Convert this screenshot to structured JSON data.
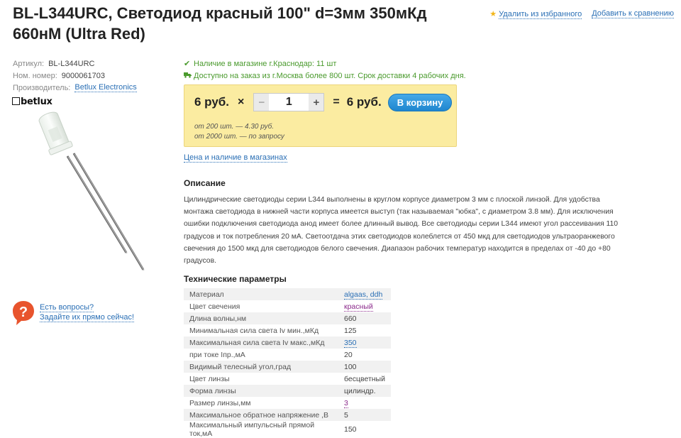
{
  "product": {
    "title": "BL-L344URC, Светодиод красный 100\" d=3мм 350мКд 660нМ (Ultra Red)"
  },
  "actions": {
    "remove_favorite": "Удалить из избранного",
    "add_compare": "Добавить к сравнению"
  },
  "meta": {
    "article_label": "Артикул:",
    "article_value": "BL-L344URC",
    "number_label": "Ном. номер:",
    "number_value": "9000061703",
    "maker_label": "Производитель:",
    "maker_value": "Betlux Electronics"
  },
  "brand_logo": "betlux",
  "availability": {
    "in_store": "Наличие в магазине г.Краснодар: 11 шт",
    "on_order": "Доступно на заказ из г.Москва более 800 шт. Срок доставки 4 рабочих дня."
  },
  "buy": {
    "unit_price": "6 руб.",
    "times": "×",
    "minus": "−",
    "plus": "+",
    "qty": "1",
    "equals": "=",
    "total": "6 руб.",
    "cart_button": "В корзину",
    "tier1": "от 200 шт. — 4.30 руб.",
    "tier2": "от 2000 шт. — по запросу"
  },
  "stores_link": "Цена и наличие в магазинах",
  "description": {
    "heading": "Описание",
    "text": "Цилиндрические светодиоды серии L344 выполнены в круглом корпусе диаметром 3 мм с плоской линзой. Для удобства монтажа светодиода в нижней части корпуса имеется выступ (так называемая \"юбка\", с диаметром 3.8 мм). Для исключения ошибки подключения светодиода анод имеет более длинный вывод. Все светодиоды серии L344 имеют угол рассеивания 110 градусов и ток потребления 20 мА. Светоотдача этих светодиодов колеблется от 450 мкд для светодиодов ультраоранжевого свечения до 1500 мкд для светодиодов белого свечения. Диапазон рабочих температур находится в пределах от -40 до +80 градусов."
  },
  "help": {
    "line1": "Есть вопросы?",
    "line2": "Задайте их прямо сейчас!"
  },
  "specs": {
    "heading": "Технические параметры",
    "rows": [
      {
        "key": "Материал",
        "value": "algaas, ddh",
        "link": "blue"
      },
      {
        "key": "Цвет свечения",
        "value": "красный",
        "link": "purple"
      },
      {
        "key": "Длина волны,нм",
        "value": "660",
        "link": ""
      },
      {
        "key": "Минимальная сила света Iv мин.,мКд",
        "value": "125",
        "link": ""
      },
      {
        "key": "Максимальная сила света Iv макс.,мКд",
        "value": "350",
        "link": "blue"
      },
      {
        "key": "при токе Iпр.,мА",
        "value": "20",
        "link": ""
      },
      {
        "key": "Видимый телесный угол,град",
        "value": "100",
        "link": ""
      },
      {
        "key": "Цвет линзы",
        "value": "бесцветный",
        "link": ""
      },
      {
        "key": "Форма линзы",
        "value": "цилиндр.",
        "link": ""
      },
      {
        "key": "Размер линзы,мм",
        "value": "3",
        "link": "purple"
      },
      {
        "key": "Максимальное обратное напряжение ,В",
        "value": "5",
        "link": ""
      },
      {
        "key": "Максимальный импульсный прямой ток,мА",
        "value": "150",
        "link": ""
      }
    ]
  },
  "colors": {
    "link": "#2a6fb5",
    "visited_link": "#8b2a8b",
    "stock_green": "#4a9a2d",
    "buybox_bg": "#fbeca1",
    "cart_button": "#1f86cf"
  }
}
